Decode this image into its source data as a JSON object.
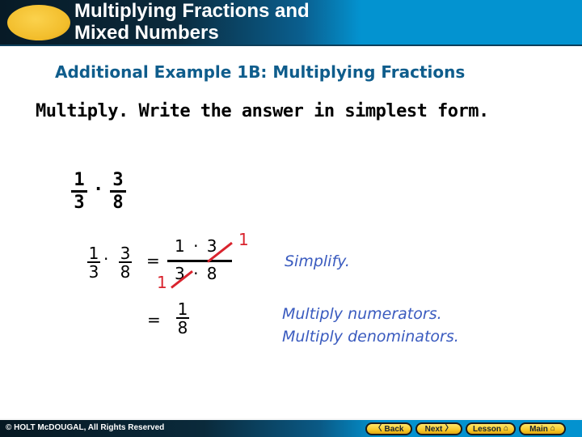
{
  "header": {
    "title_line1": "Multiplying Fractions and",
    "title_line2": "Mixed Numbers",
    "colors": {
      "oval": "#f2bd2b",
      "bar_dark": "#071a26",
      "bar_light": "#0393d0"
    }
  },
  "subtitle": "Additional Example 1B: Multiplying Fractions",
  "instruction": "Multiply. Write the answer in simplest form.",
  "problem": {
    "fraction1": {
      "numerator": "1",
      "denominator": "3"
    },
    "operator": "·",
    "fraction2": {
      "numerator": "3",
      "denominator": "8"
    }
  },
  "work": {
    "step1": {
      "fraction1": {
        "numerator": "1",
        "denominator": "3"
      },
      "operator": "·",
      "fraction2": {
        "numerator": "3",
        "denominator": "8"
      },
      "equals": "=",
      "combined_numerator": "1 · 3",
      "combined_denominator": "3 · 8",
      "cancel_top_result": "1",
      "cancel_bottom_result": "1",
      "cancel_color": "#d9232d"
    },
    "step2": {
      "equals": "=",
      "result": {
        "numerator": "1",
        "denominator": "8"
      }
    }
  },
  "notes": {
    "note1": "Simplify.",
    "note2_line1": "Multiply numerators.",
    "note2_line2": "Multiply denominators.",
    "color": "#3a5bbf"
  },
  "footer": {
    "copyright": "© HOLT McDOUGAL, All Rights Reserved",
    "buttons": [
      {
        "label": "Back",
        "icon": "chevron-left-icon",
        "glyph": "〈"
      },
      {
        "label": "Next",
        "icon": "chevron-right-icon",
        "glyph": "〉"
      },
      {
        "label": "Lesson",
        "icon": "home-icon",
        "glyph": "⌂"
      },
      {
        "label": "Main",
        "icon": "home-icon",
        "glyph": "⌂"
      }
    ]
  }
}
